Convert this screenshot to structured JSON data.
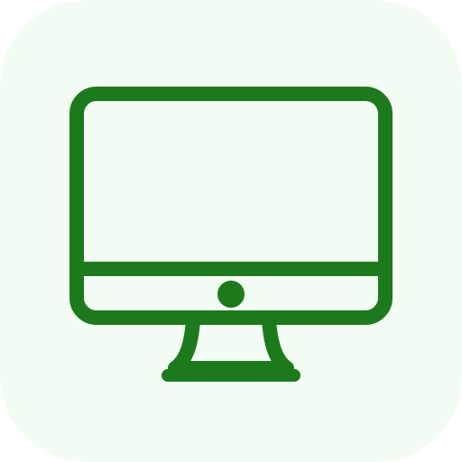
{
  "icon": {
    "name": "desktop-computer-icon",
    "colors": {
      "background": "#f2fcf2",
      "stroke": "#1c7a1c"
    }
  }
}
